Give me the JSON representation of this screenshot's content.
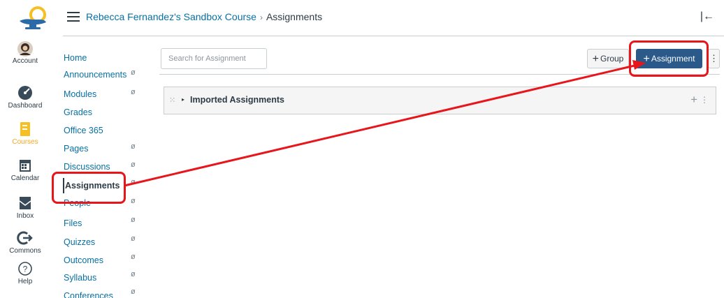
{
  "global_nav": {
    "logo_icon": "lamp-logo-icon",
    "items": [
      {
        "label": "Account",
        "icon": "avatar"
      },
      {
        "label": "Dashboard",
        "icon": "dashboard-icon"
      },
      {
        "label": "Courses",
        "icon": "courses-icon",
        "active": true
      },
      {
        "label": "Calendar",
        "icon": "calendar-icon"
      },
      {
        "label": "Inbox",
        "icon": "inbox-icon"
      },
      {
        "label": "Commons",
        "icon": "commons-icon"
      },
      {
        "label": "Help",
        "icon": "help-icon"
      }
    ],
    "active_color": "#f6a623"
  },
  "header": {
    "breadcrumb_course": "Rebecca Fernandez's Sandbox Course",
    "breadcrumb_separator": "›",
    "breadcrumb_current": "Assignments",
    "collapse_icon": "|←"
  },
  "course_nav": {
    "items": [
      {
        "label": "Home",
        "hidden_icon": false
      },
      {
        "label": "Announcements",
        "hidden_icon": true
      },
      {
        "label": "Modules",
        "hidden_icon": true
      },
      {
        "label": "Grades",
        "hidden_icon": false
      },
      {
        "label": "Office 365",
        "hidden_icon": false
      },
      {
        "label": "Pages",
        "hidden_icon": true
      },
      {
        "label": "Discussions",
        "hidden_icon": true
      },
      {
        "label": "Assignments",
        "hidden_icon": true,
        "active": true
      },
      {
        "label": "People",
        "hidden_icon": true
      },
      {
        "label": "Files",
        "hidden_icon": true
      },
      {
        "label": "Quizzes",
        "hidden_icon": true
      },
      {
        "label": "Outcomes",
        "hidden_icon": true
      },
      {
        "label": "Syllabus",
        "hidden_icon": true
      },
      {
        "label": "Conferences",
        "hidden_icon": true
      }
    ],
    "hidden_glyph": "ø"
  },
  "toolbar": {
    "search_placeholder": "Search for Assignment",
    "group_button_label": "Group",
    "assignment_button_label": "Assignment",
    "plus_glyph": "+",
    "kebab_glyph": "⋮",
    "primary_color": "#2b5a8a"
  },
  "assignment_group": {
    "title": "Imported Assignments",
    "drag_glyph": "⁙",
    "caret_glyph": "▸",
    "add_glyph": "+",
    "menu_glyph": "⋮"
  },
  "annotation": {
    "color": "#e8151b"
  }
}
